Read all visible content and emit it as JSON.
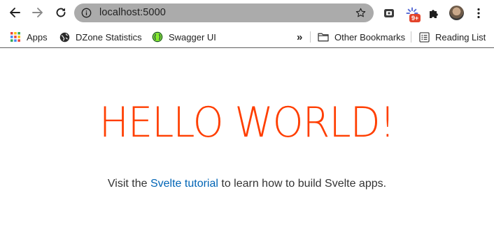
{
  "browser": {
    "url": "localhost:5000",
    "extension_badge": "9+"
  },
  "bookmarks_bar": {
    "items": [
      {
        "label": "Apps",
        "icon": "apps-grid-icon"
      },
      {
        "label": "DZone Statistics",
        "icon": "globe-icon"
      },
      {
        "label": "Swagger UI",
        "icon": "swagger-icon"
      }
    ],
    "overflow_label": "»",
    "other_bookmarks": "Other Bookmarks",
    "reading_list": "Reading List"
  },
  "page": {
    "heading": "HELLO WORLD!",
    "text_before": "Visit the ",
    "link_text": "Svelte tutorial",
    "text_after": " to learn how to build Svelte apps."
  },
  "colors": {
    "heading": "#ff3e00",
    "link": "#0064b5",
    "omnibox": "#ababab"
  }
}
